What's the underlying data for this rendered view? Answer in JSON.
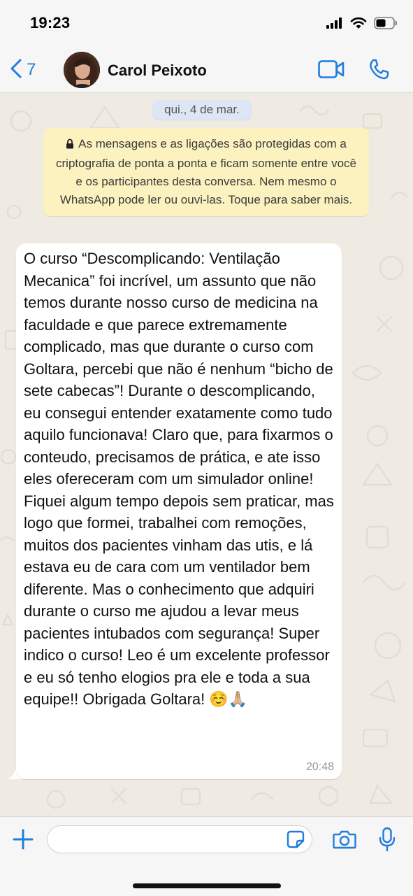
{
  "status_bar": {
    "time": "19:23",
    "icons": [
      "cellular-signal-icon",
      "wifi-icon",
      "battery-icon"
    ]
  },
  "header": {
    "back_count": "7",
    "contact_name": "Carol Peixoto",
    "icons": [
      "chevron-left-icon",
      "video-call-icon",
      "phone-icon"
    ],
    "accent_color": "#1f7ddb"
  },
  "chat": {
    "date_label": "qui., 4 de mar.",
    "encryption_notice": "As mensagens e as ligações são protegidas com a criptografia de ponta a ponta e ficam somente entre você e os participantes desta conversa. Nem mesmo o WhatsApp pode ler ou ouvi-las. Toque para saber mais.",
    "message": {
      "text": "O curso “Descomplicando: Ventilação Mecanica” foi incrível, um assunto que não temos durante nosso curso de medicina na faculdade e que parece extremamente complicado, mas que durante o curso com Goltara, percebi que não é nenhum “bicho de sete cabecas”! Durante o descomplicando, eu consegui entender exatamente como tudo aquilo funcionava! Claro que, para fixarmos o conteudo, precisamos de prática, e ate isso eles ofereceram com um simulador online! Fiquei algum tempo depois sem praticar, mas logo que formei, trabalhei com remoções, muitos dos pacientes vinham das utis, e lá estava eu de cara com um ventilador bem diferente. Mas o conhecimento que adquiri durante o curso me ajudou a levar meus pacientes intubados com segurança! Super indico o curso! Leo é um excelente professor e eu só tenho elogios pra ele e toda a sua equipe!! Obrigada Goltara! ☺️🙏🏼",
      "time": "20:48"
    },
    "colors": {
      "wallpaper": "#efeae2",
      "notice_bg": "#fcf2c0",
      "date_pill_bg": "#dde6f4",
      "bubble_bg": "#ffffff"
    }
  },
  "input_bar": {
    "input_value": "",
    "icons": [
      "plus-icon",
      "sticker-icon",
      "camera-icon",
      "microphone-icon"
    ]
  }
}
